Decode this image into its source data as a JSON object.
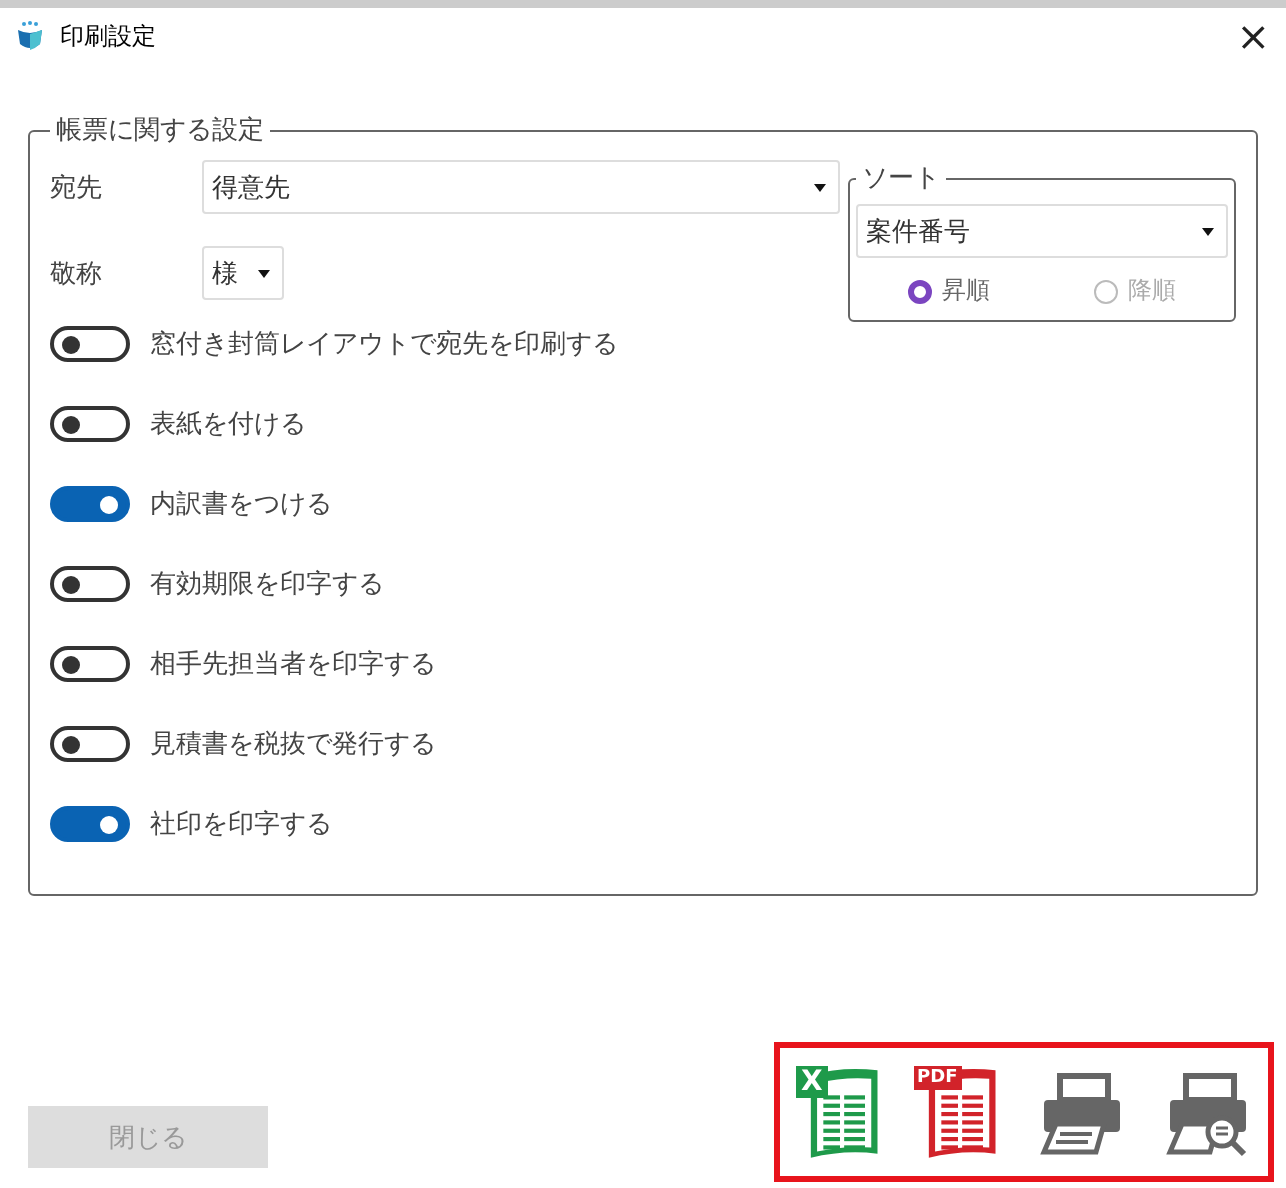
{
  "window": {
    "title": "印刷設定",
    "close": "×"
  },
  "group": {
    "legend": "帳票に関する設定",
    "address": {
      "label": "宛先",
      "value": "得意先"
    },
    "honorific": {
      "label": "敬称",
      "value": "様"
    },
    "toggles": [
      {
        "label": "窓付き封筒レイアウトで宛先を印刷する",
        "on": false
      },
      {
        "label": "表紙を付ける",
        "on": false
      },
      {
        "label": "内訳書をつける",
        "on": true
      },
      {
        "label": "有効期限を印字する",
        "on": false
      },
      {
        "label": "相手先担当者を印字する",
        "on": false
      },
      {
        "label": "見積書を税抜で発行する",
        "on": false
      },
      {
        "label": "社印を印字する",
        "on": true
      }
    ]
  },
  "sort": {
    "legend": "ソート",
    "value": "案件番号",
    "orders": [
      {
        "label": "昇順",
        "selected": true
      },
      {
        "label": "降順",
        "selected": false
      }
    ]
  },
  "close_button": {
    "label": "閉じる",
    "disabled": true
  },
  "outputs": [
    {
      "kind": "excel",
      "tag": "X"
    },
    {
      "kind": "pdf",
      "tag": "PDF"
    },
    {
      "kind": "print"
    },
    {
      "kind": "preview"
    }
  ]
}
